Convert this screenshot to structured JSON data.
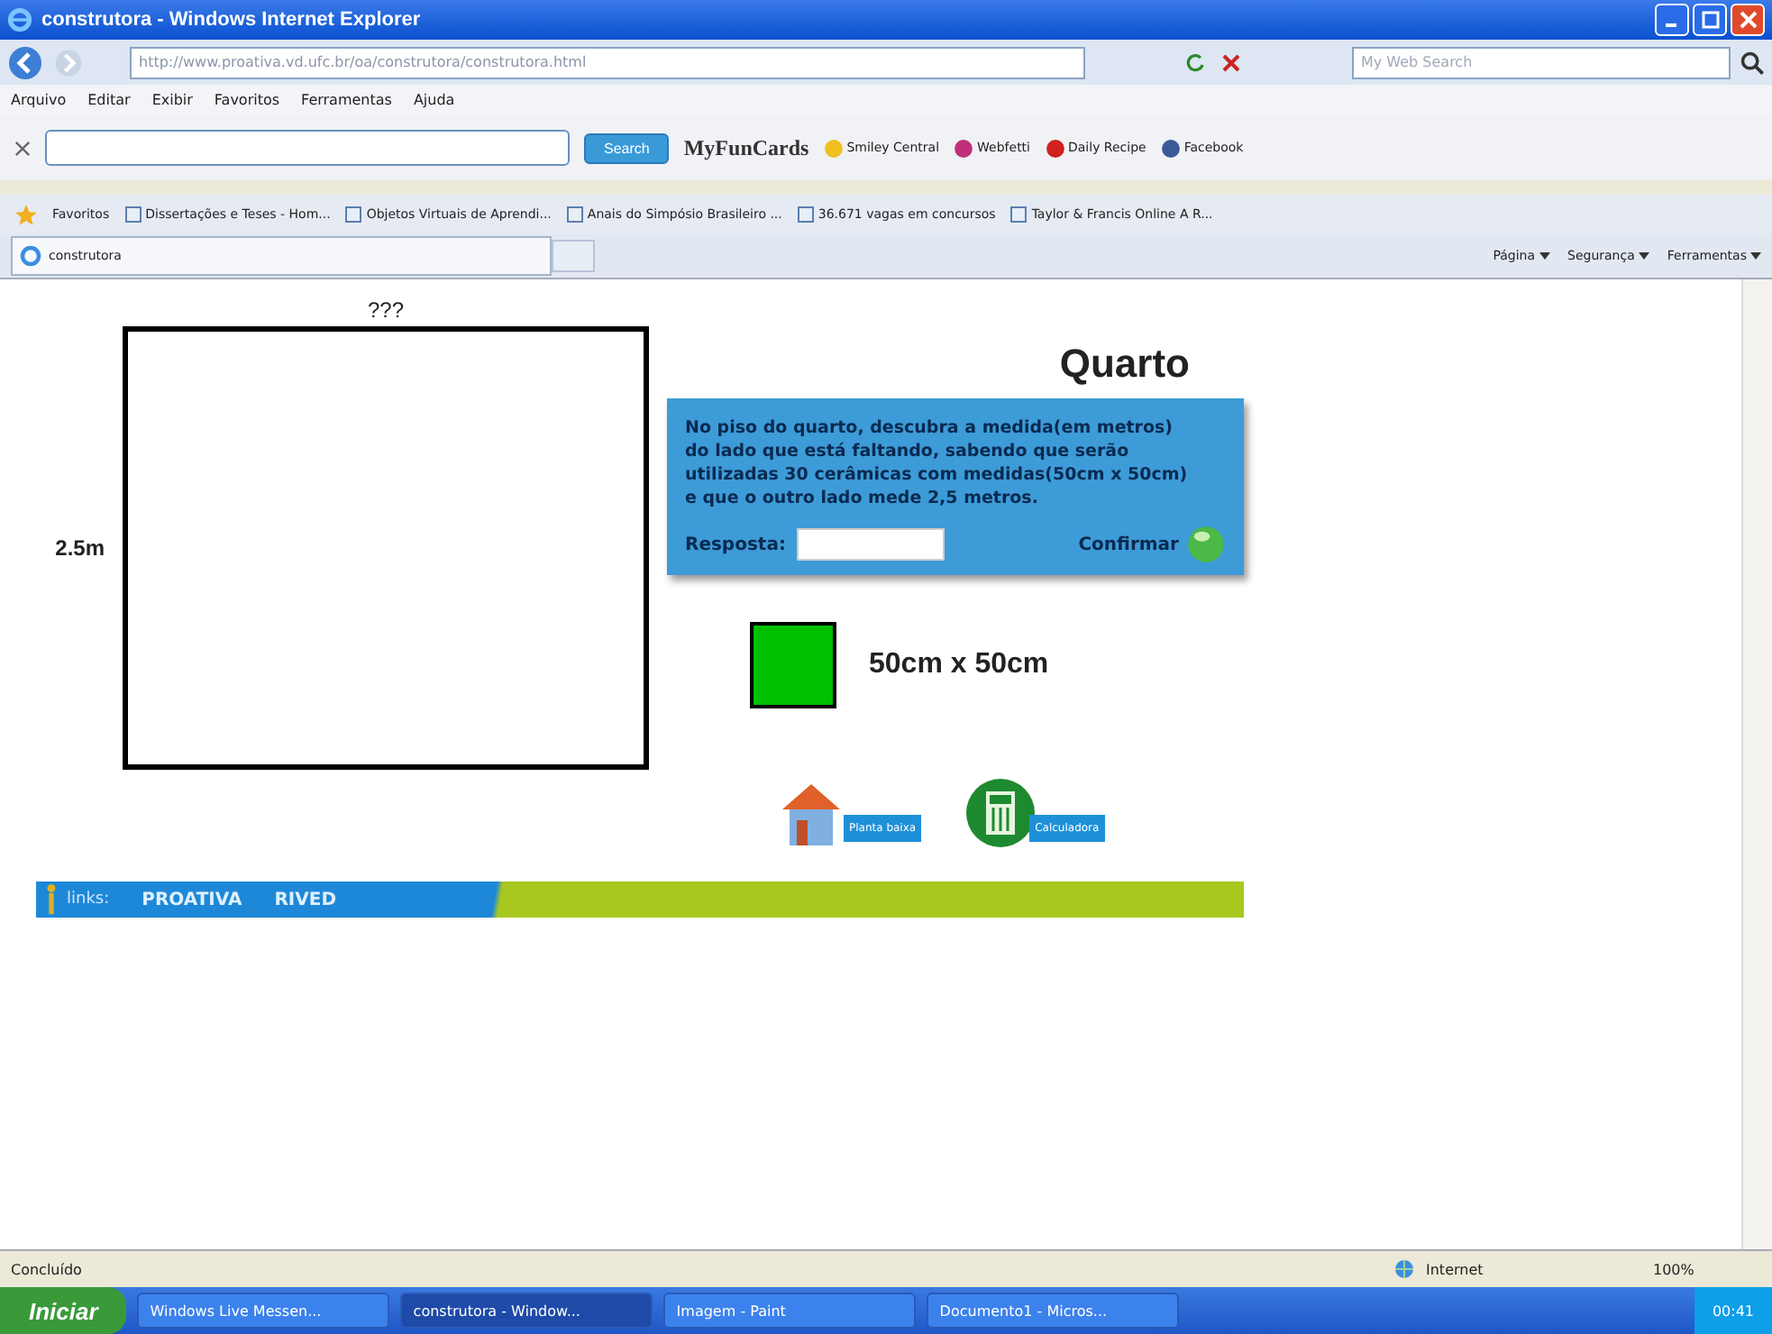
{
  "window": {
    "title": "construtora - Windows Internet Explorer"
  },
  "address_bar": {
    "url": "http://www.proativa.vd.ufc.br/oa/construtora/construtora.html"
  },
  "search_box": {
    "placeholder": "My Web Search"
  },
  "menu": [
    "Arquivo",
    "Editar",
    "Exibir",
    "Favoritos",
    "Ferramentas",
    "Ajuda"
  ],
  "toolbar": {
    "search_button": "Search",
    "brand": "MyFunCards",
    "links": [
      "Smiley Central",
      "Webfetti",
      "Daily Recipe",
      "Facebook"
    ]
  },
  "favorites_bar": {
    "label": "Favoritos",
    "links": [
      "Dissertações e Teses - Hom...",
      "Objetos Virtuais de Aprendi...",
      "Anais do Simpósio Brasileiro ...",
      "36.671 vagas em concursos",
      "Taylor & Francis Online  A R..."
    ]
  },
  "tab": {
    "title": "construtora"
  },
  "command_bar": [
    "Página",
    "Segurança",
    "Ferramentas"
  ],
  "page": {
    "top_label": "???",
    "side_label": "2.5m",
    "title": "Quarto",
    "question": "No piso do quarto, descubra a medida(em metros) do lado que está faltando, sabendo que serão utilizadas 30 cerâmicas com medidas(50cm x 50cm) e que o outro lado mede 2,5 metros.",
    "answer_label": "Resposta:",
    "confirm": "Confirmar",
    "tile_label": "50cm x 50cm",
    "buttons": [
      {
        "kind": "house",
        "label": "Planta baixa"
      },
      {
        "kind": "calculator",
        "label": "Calculadora"
      }
    ],
    "links_bar": {
      "label": "links:",
      "links": [
        "PROATIVA",
        "RIVED"
      ]
    }
  },
  "status_bar": {
    "text": "Concluído",
    "zone": "Internet",
    "zoom": "100%"
  },
  "taskbar": {
    "start": "Iniciar",
    "clock": "00:41",
    "items": [
      {
        "label": "Windows Live Messen...",
        "selected": false
      },
      {
        "label": "construtora - Window...",
        "selected": true
      },
      {
        "label": "Imagem - Paint",
        "selected": false
      },
      {
        "label": "Documento1 - Micros...",
        "selected": false
      }
    ]
  }
}
